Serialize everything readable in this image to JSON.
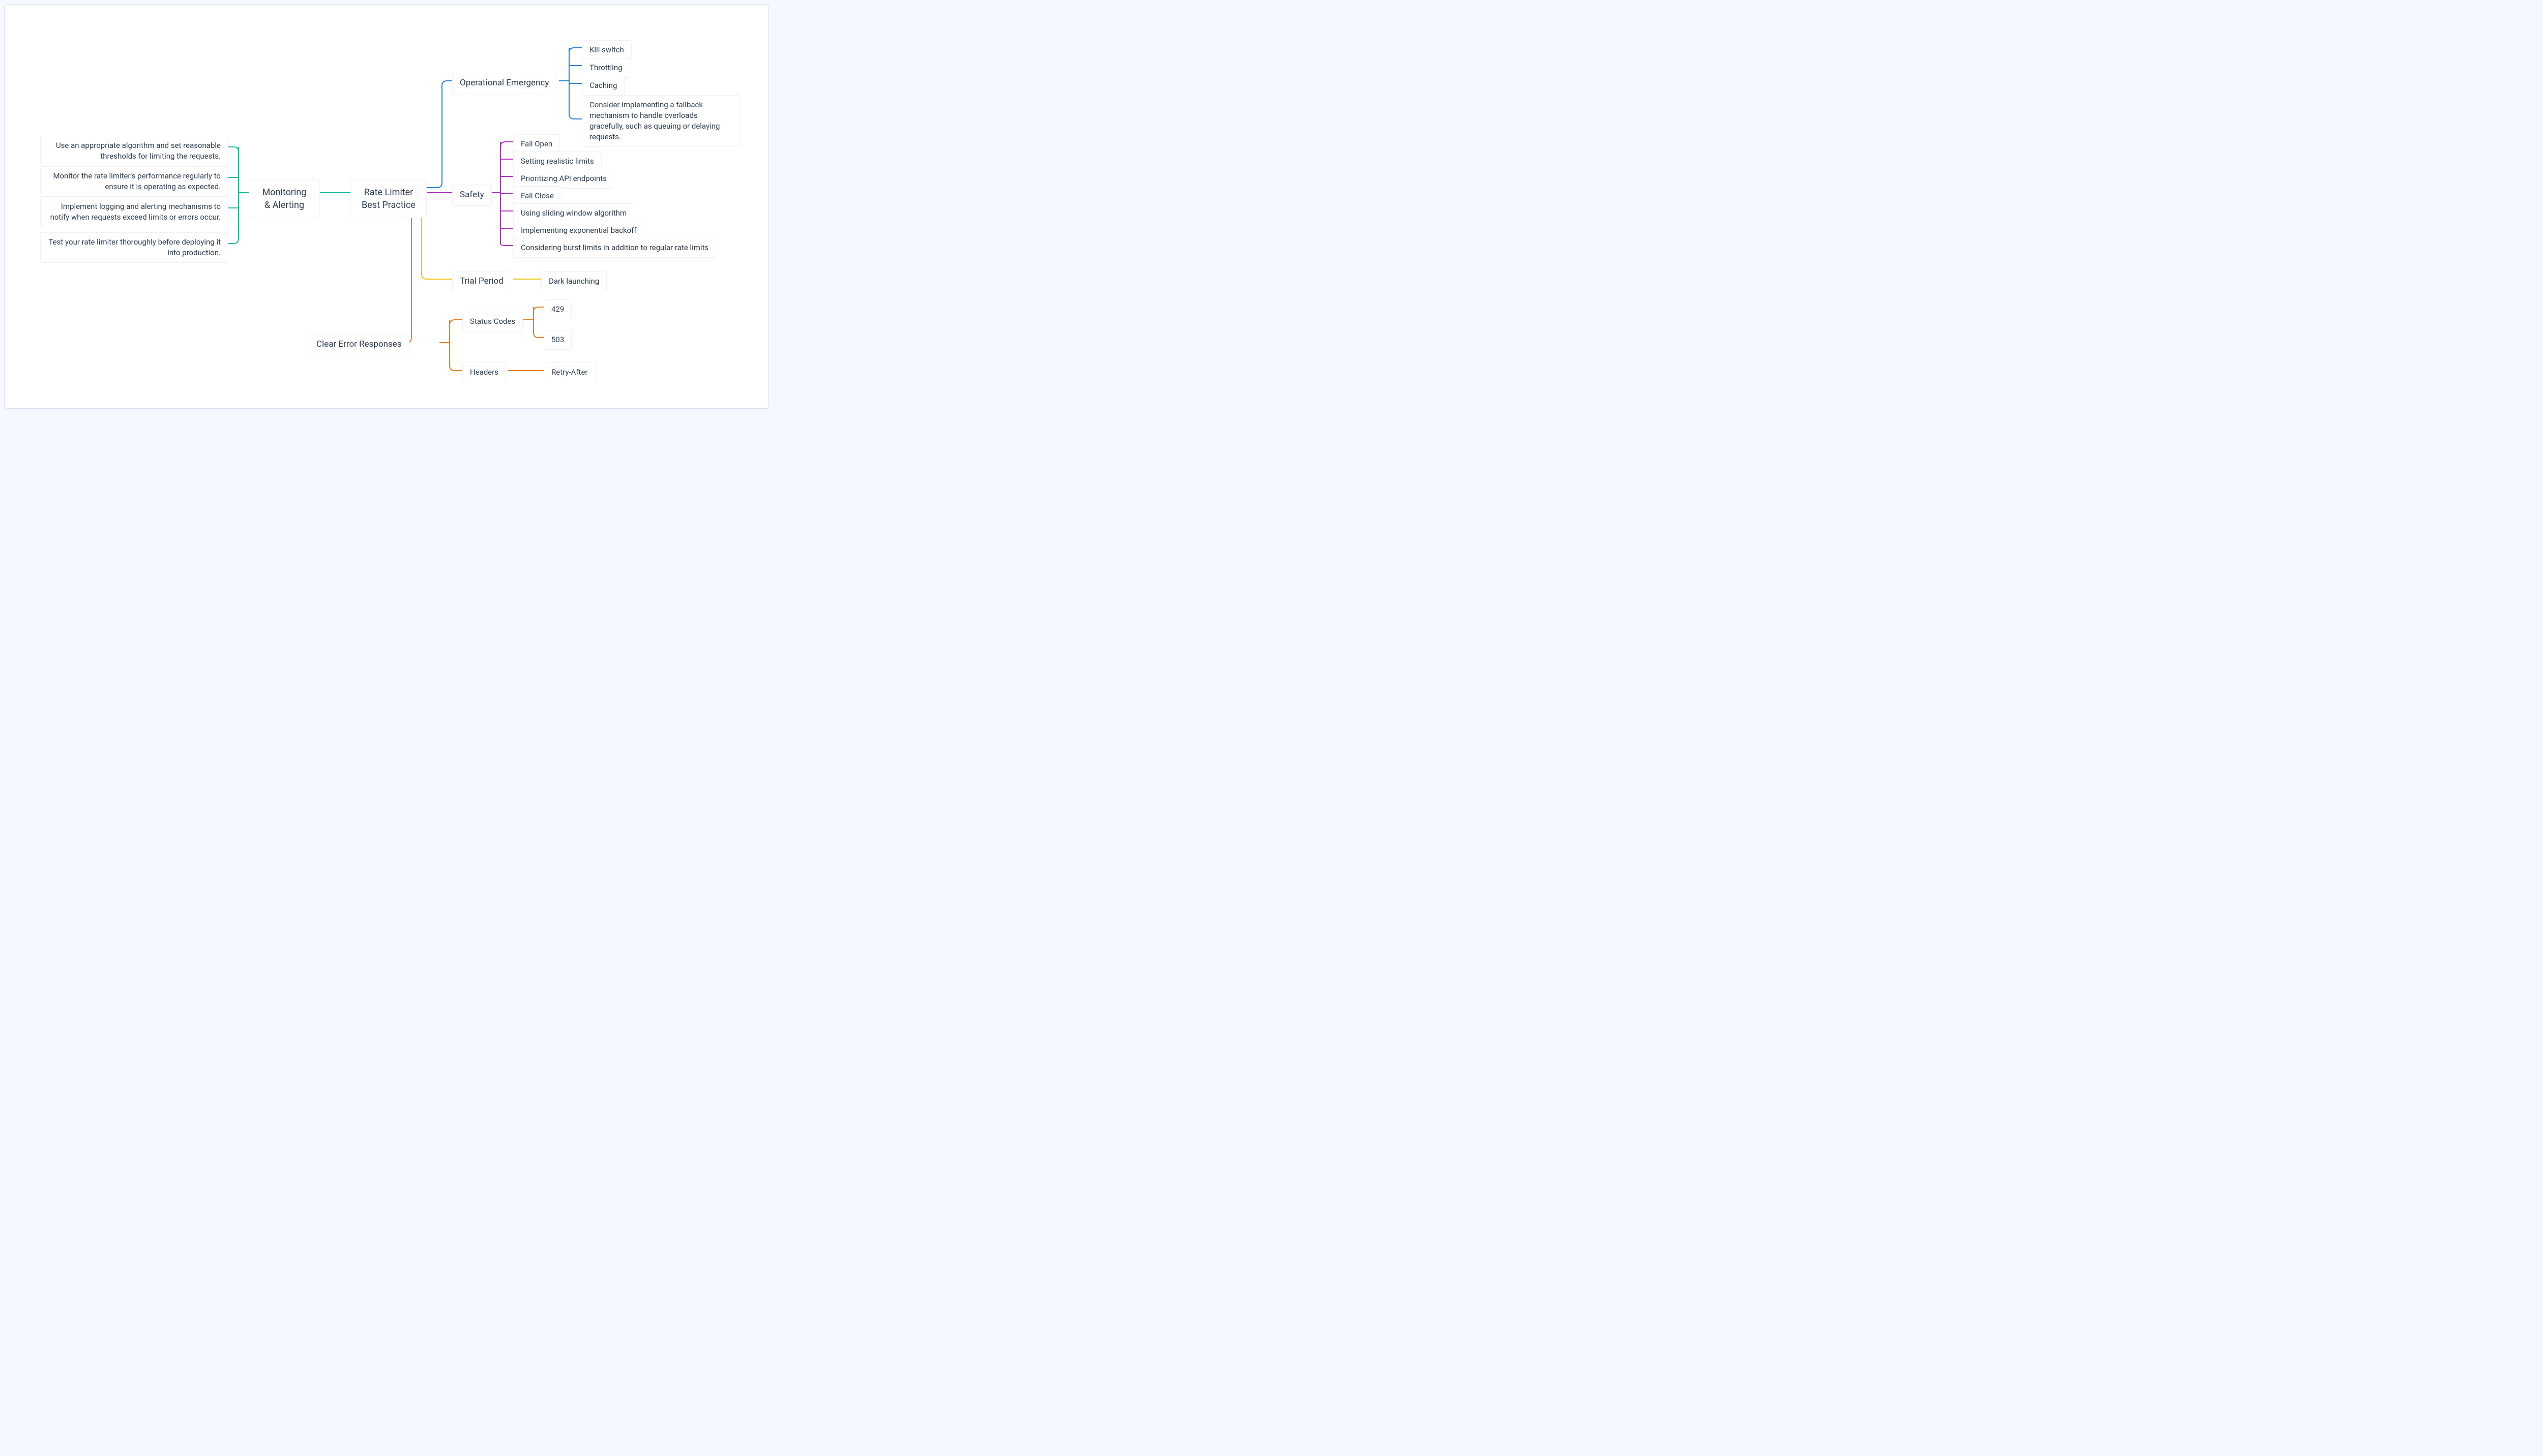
{
  "root": {
    "label": "Rate Limiter\nBest Practice"
  },
  "left": {
    "branch": {
      "label": "Monitoring & Alerting",
      "color": "#1abc9c"
    },
    "items": [
      "Use an appropriate algorithm and set reasonable thresholds for limiting the requests.",
      "Monitor the rate limiter's performance regularly to ensure it is operating as expected.",
      "Implement logging and alerting mechanisms to notify when requests exceed limits or errors occur.",
      "Test your rate limiter thoroughly before deploying it into production."
    ]
  },
  "right": {
    "operational": {
      "label": "Operational Emergency",
      "color": "#2980d9",
      "items": [
        "Kill switch",
        "Throttling",
        "Caching",
        "Consider implementing a fallback mechanism to handle overloads gracefully, such as queuing or delaying requests."
      ]
    },
    "safety": {
      "label": "Safety",
      "color": "#b030c0",
      "items": [
        "Fail Open",
        "Setting realistic limits",
        "Prioritizing API endpoints",
        "Fail Close",
        "Using sliding window algorithm",
        "Implementing exponential backoff",
        "Considering burst limits in addition to regular rate limits"
      ]
    },
    "trial": {
      "label": "Trial Period",
      "color": "#f1c40f",
      "items": [
        "Dark launching"
      ]
    },
    "errors": {
      "label": "Clear Error Responses",
      "color": "#e67e22",
      "children": {
        "status": {
          "label": "Status Codes",
          "items": [
            "429",
            "503"
          ]
        },
        "headers": {
          "label": "Headers",
          "items": [
            "Retry-After"
          ]
        }
      }
    }
  }
}
